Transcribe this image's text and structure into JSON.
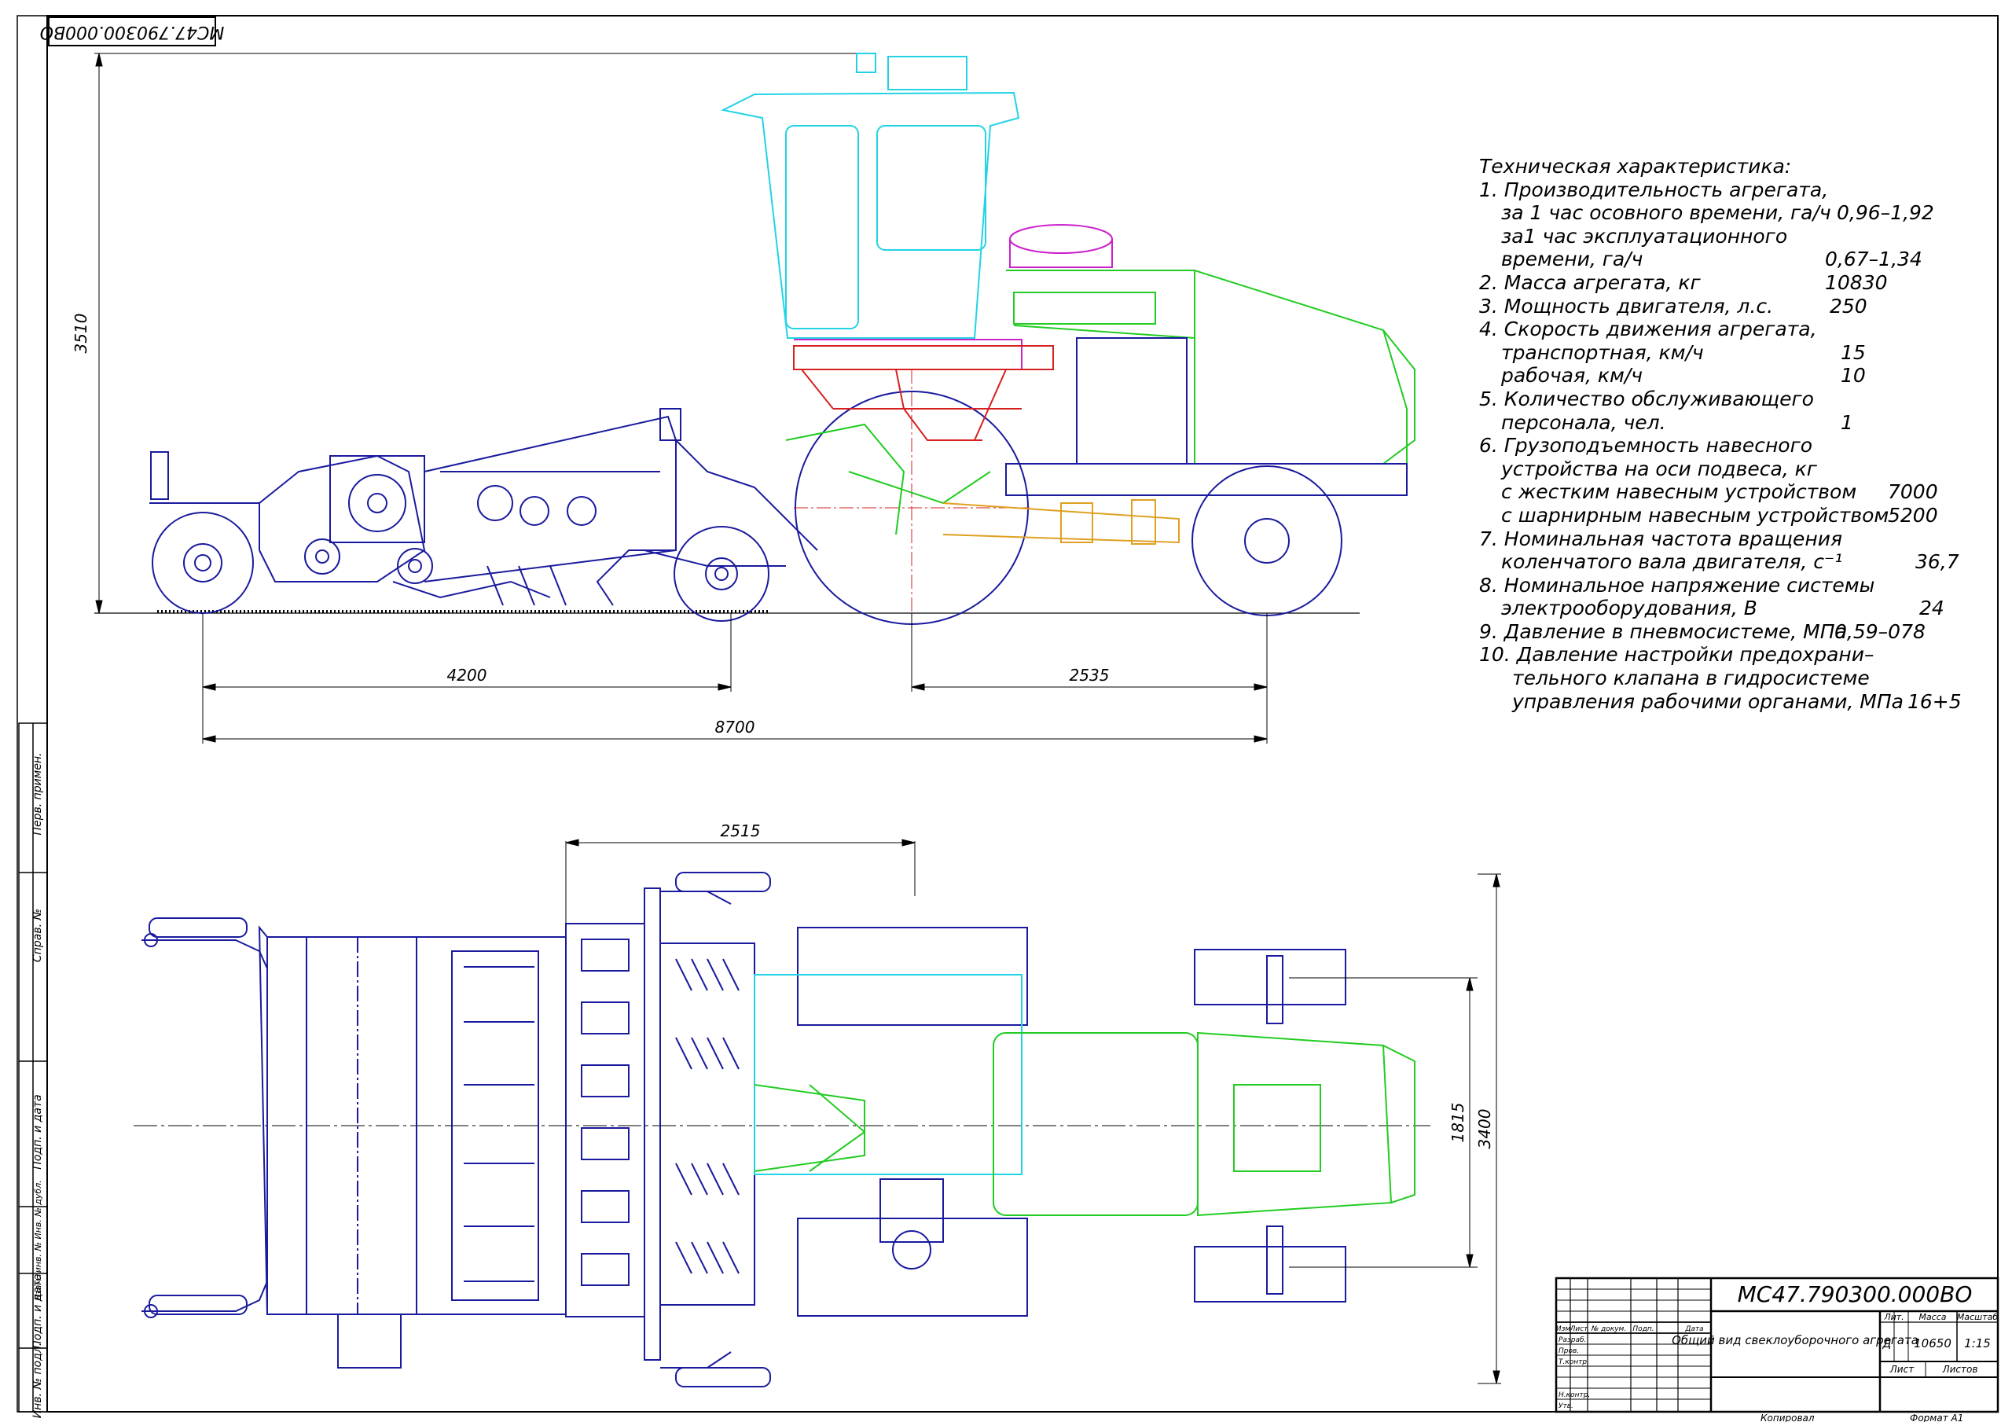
{
  "doc_code_rotated": "МС47.790300.000ВО",
  "dimensions": {
    "height_side": "3510",
    "rear_to_axle": "4200",
    "axle_base": "2535",
    "overall_length": "8700",
    "top_front": "2515",
    "track": "1815",
    "width": "3400"
  },
  "spec": {
    "title": "Техническая характеристика:",
    "rows": [
      {
        "text": "1. Производительность агрегата,",
        "value": ""
      },
      {
        "text": "за 1 час осовного времени, га/ч",
        "value": "0,96–1,92"
      },
      {
        "text": "за1 час эксплуатационного",
        "value": ""
      },
      {
        "text": "времени, га/ч",
        "value": "0,67–1,34"
      },
      {
        "text": "2. Масса агрегата, кг",
        "value": "10830"
      },
      {
        "text": "3. Мощность двигателя, л.с.",
        "value": "250"
      },
      {
        "text": "4. Скорость движения агрегата,",
        "value": ""
      },
      {
        "text": "транспортная, км/ч",
        "value": "15"
      },
      {
        "text": "рабочая, км/ч",
        "value": "10"
      },
      {
        "text": "5. Количество обслуживающего",
        "value": ""
      },
      {
        "text": "персонала, чел.",
        "value": "1"
      },
      {
        "text": "6. Грузоподъемность навесного",
        "value": ""
      },
      {
        "text": "устройства на оси подвеса, кг",
        "value": ""
      },
      {
        "text": "с жестким навесным устройством",
        "value": "7000"
      },
      {
        "text": "с шарнирным навесным устройством",
        "value": "5200"
      },
      {
        "text": "7. Номинальная частота вращения",
        "value": ""
      },
      {
        "text": "коленчатого вала двигателя, с⁻¹",
        "value": "36,7"
      },
      {
        "text": "8. Номинальное напряжение системы",
        "value": ""
      },
      {
        "text": "электрооборудования, В",
        "value": "24"
      },
      {
        "text": "9. Давление в пневмосистеме, МПа",
        "value": "0,59–078"
      },
      {
        "text": "10. Давление настройки предохрани–",
        "value": ""
      },
      {
        "text": "тельного клапана в гидросистеме",
        "value": ""
      },
      {
        "text": "управления рабочими органами, МПа",
        "value": "16+5"
      }
    ]
  },
  "left_strip": [
    "Перв. примен.",
    "Справ. №",
    "Подп. и дата",
    "Взам. инв. № Инв. № дубл.",
    "Подп. и дата",
    "Инв. № подл."
  ],
  "title_block": {
    "designation": "МС47.790300.000ВО",
    "name": "Общий вид свеклоуборочного агрегата",
    "col_headers": [
      "Изм",
      "Лист",
      "№ докум.",
      "Подп.",
      "Дата"
    ],
    "roles": [
      "Разраб.",
      "Пров.",
      "Т.контр.",
      "",
      "Н.контр.",
      "Утв."
    ],
    "lit_label": "Лит.",
    "mass_label": "Масса",
    "scale_label": "Масштаб",
    "lit_value": "Д",
    "mass_value": "10650",
    "scale_value": "1:15",
    "sheet_label": "Лист",
    "sheets_label": "Листов",
    "copied": "Копировал",
    "format": "Формат   А1"
  },
  "colors": {
    "frame": "#000000",
    "machine_blue": "#1a1a9e",
    "cab_cyan": "#22d3e6",
    "body_green": "#22cc22",
    "frame_red": "#d62020",
    "tank_magenta": "#cc22cc",
    "orange": "#e0a020",
    "dim_line": "#000000"
  }
}
